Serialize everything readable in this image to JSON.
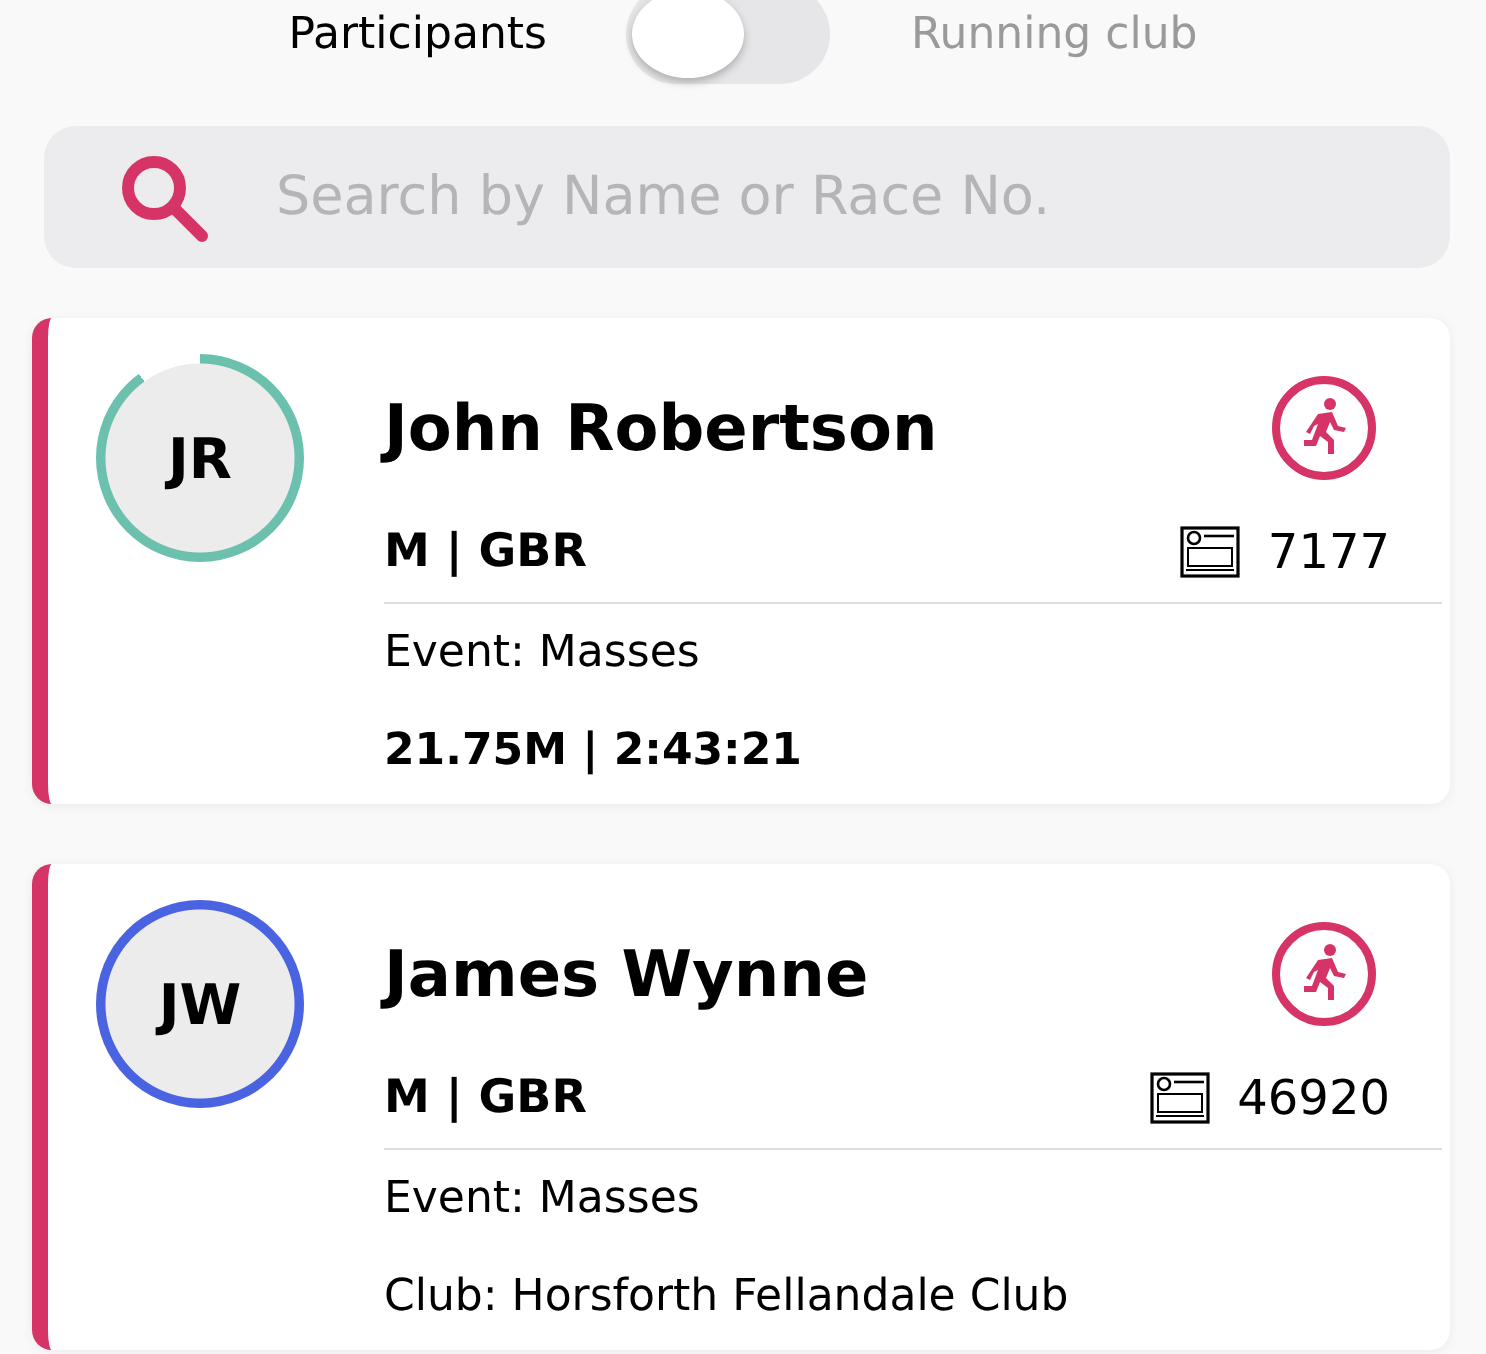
{
  "view_switch": {
    "left_label": "Participants",
    "right_label": "Running club",
    "on": false
  },
  "search": {
    "placeholder": "Search by Name or Race No."
  },
  "participants": [
    {
      "initials": "JR",
      "color": "#6cc0ae",
      "kind": "partial_ring",
      "name": "John Robertson",
      "gender_country": "M | GBR",
      "race_no": "7177",
      "details": [
        {
          "kind": "plain",
          "text": "Event: Masses"
        },
        {
          "kind": "bold",
          "text": "21.75M | 2:43:21"
        }
      ]
    },
    {
      "initials": "JW",
      "color": "#4a63e0",
      "kind": "full_ring",
      "name": "James Wynne",
      "gender_country": "M | GBR",
      "race_no": "46920",
      "details": [
        {
          "kind": "plain",
          "text": "Event: Masses"
        },
        {
          "kind": "plain",
          "text": "Club: Horsforth Fellandale Club"
        }
      ]
    }
  ]
}
